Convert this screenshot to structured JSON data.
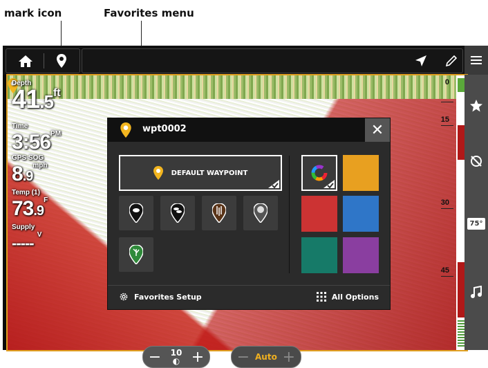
{
  "annotations": {
    "mark_icon": "mark icon",
    "favorites_menu": "Favorites menu"
  },
  "topbar": {
    "icons": [
      "home-icon",
      "waypoint-pin-icon",
      "navigation-arrow-icon",
      "pencil-icon",
      "menu-icon"
    ]
  },
  "readouts": {
    "depth_label": "Depth",
    "depth_value": "41",
    "depth_decimal": ".5",
    "depth_unit": "ft",
    "time_label": "Time",
    "time_value": "3:56",
    "time_ampm": "PM",
    "sog_label": "GPS SOG",
    "sog_value": "8",
    "sog_decimal": ".9",
    "sog_unit": "mph",
    "temp_label": "Temp (1)",
    "temp_value": "73",
    "temp_decimal": ".9",
    "temp_unit": "F",
    "supply_label": "Supply",
    "supply_value": "----- ",
    "supply_unit": "V"
  },
  "depth_scale": [
    "0",
    "15",
    "30",
    "45"
  ],
  "right_toolbar": {
    "icons": [
      "star-icon",
      "sonar-icon",
      "water-temp-icon",
      "music-icon"
    ],
    "temp_label": "75°"
  },
  "bottom_controls": {
    "range_value": "10",
    "mode_value": "Auto"
  },
  "dialog": {
    "title": "wpt0002",
    "default_label": "DEFAULT WAYPOINT",
    "footer_setup": "Favorites Setup",
    "footer_all": "All Options",
    "icon_tiles": [
      "fish-icon",
      "fish-school-icon",
      "structure-icon",
      "bait-icon",
      "vegetation-icon"
    ],
    "colors": [
      "#e8a020",
      "#cc3333",
      "#2f76c8",
      "#167a68",
      "#8a3ea0"
    ]
  }
}
